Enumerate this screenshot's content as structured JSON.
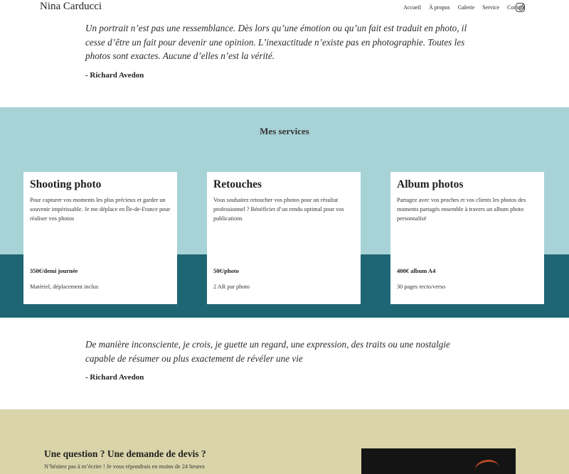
{
  "header": {
    "site_name": "Nina Carducci",
    "nav": {
      "accueil": "Accueil",
      "a_propos": "À propos",
      "galerie": "Galerie",
      "service": "Service",
      "contact": "Contact"
    },
    "social_icon": "instagram-icon"
  },
  "quote1": {
    "text": "Un portrait n’est pas une ressemblance. Dès lors qu’une émotion ou qu’un fait est traduit en photo, il cesse d’être un fait pour devenir une opinion. L’inexactitude n’existe pas en photographie. Toutes les photos sont exactes. Aucune d’elles n’est la vérité.",
    "author": "- Richard Avedon"
  },
  "services": {
    "title": "Mes services",
    "cards": [
      {
        "title": "Shooting photo",
        "description": "Pour capturer vos moments les plus précieux et garder un souvenir impérissable. Je me déplace en Île-de-France pour réaliser vos photos",
        "price": "350€/demi journée",
        "note": "Matériel, déplacement inclus"
      },
      {
        "title": "Retouches",
        "description": "Vous souhaitez retoucher vos photos pour un résultat professionnel ? Bénéficier d’un rendu optimal pour vos publications",
        "price": "50€/photo",
        "note": "2 AR par photo"
      },
      {
        "title": "Album photos",
        "description": "Partagez avec vos proches et vos clients les photos des moments partagés ensemble à travers un album photo personnalisé",
        "price": "400€ album A4",
        "note": "30 pages recto/verso"
      }
    ]
  },
  "quote2": {
    "text": "De manière inconsciente, je crois, je guette un regard, une expression, des traits ou une nostalgie capable de résumer ou plus exactement de révéler une vie",
    "author": "- Richard Avedon"
  },
  "contact": {
    "title": "Une question ? Une demande de devis ?",
    "subtitle": "N’hésitez pas à m’écrire ! Je vous répondrais en moins de 24 heures"
  },
  "colors": {
    "services_light": "#a7d3d7",
    "services_dark": "#1e6673",
    "contact_bg": "#d9d4a9"
  }
}
